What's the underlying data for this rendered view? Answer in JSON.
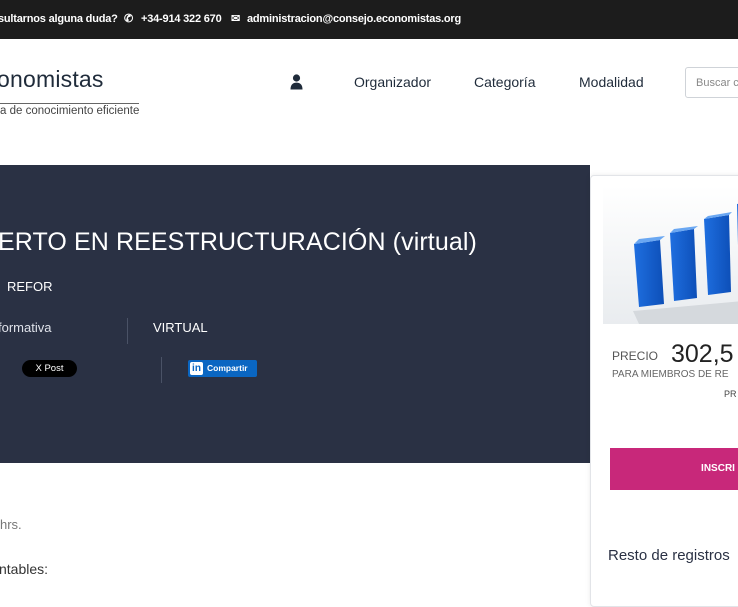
{
  "topbar": {
    "question": "sultarnos alguna duda?",
    "phone_icon": "phone-icon",
    "phone": "+34-914 322 670",
    "email_icon": "envelope-icon",
    "email": "administracion@consejo.economistas.org"
  },
  "header": {
    "logo_text": "onomistas",
    "logo_subtitle": "a de conocimiento eficiente",
    "user_icon": "user-icon",
    "nav": [
      {
        "label": "Organizador"
      },
      {
        "label": "Categoría"
      },
      {
        "label": "Modalidad"
      }
    ],
    "search_placeholder": "Buscar c"
  },
  "hero": {
    "title": "ERTO EN REESTRUCTURACIÓN (virtual)",
    "code": "REFOR",
    "type": "formativa",
    "mode": "VIRTUAL",
    "x_post_label": "X Post",
    "linkedin_label": "Compartir"
  },
  "card": {
    "image_icon": "bar-chart-image",
    "price_label": "PRECIO",
    "price_value": "302,5",
    "members_label": "PARA MIEMBROS DE RE",
    "pr_fragment": "PR",
    "button_label": "INSCRI",
    "rest_label": "Resto de registros"
  },
  "content": {
    "fragment1": "hrs.",
    "fragment2": "ntables:"
  },
  "colors": {
    "topbar": "#1c1c1c",
    "hero": "#2a3144",
    "accent": "#c8287a",
    "linkedin": "#0a66c2"
  }
}
